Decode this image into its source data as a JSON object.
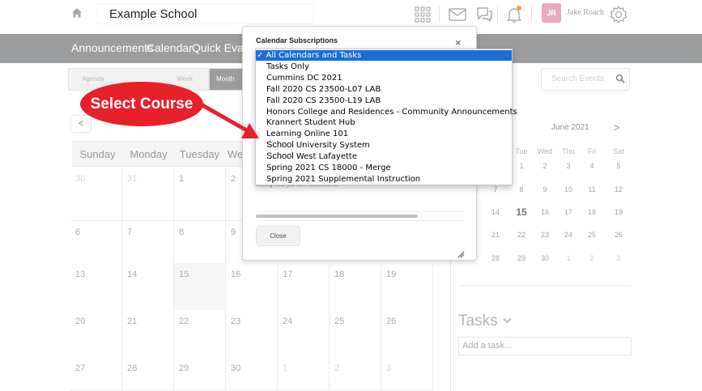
{
  "header": {
    "school_name": "Example School",
    "user_initials": "JR",
    "user_name": "Jake Roach",
    "icons": [
      "home-icon",
      "apps-grid-icon",
      "mail-icon",
      "chat-icon",
      "bell-icon",
      "gear-icon"
    ]
  },
  "navbar": {
    "items": [
      "Announcements",
      "Calendar",
      "Quick Eval"
    ]
  },
  "toolbar": {
    "view_tabs": [
      "Agenda",
      "Week",
      "Month"
    ],
    "search_placeholder": "Search Events"
  },
  "calendar": {
    "prev_label": "<",
    "weekdays": [
      "Sunday",
      "Monday",
      "Tuesday",
      "We"
    ],
    "rows": [
      [
        "30",
        "31",
        "1",
        "2"
      ],
      [
        "6",
        "7",
        "8",
        "9"
      ],
      [
        "13",
        "14",
        "15",
        "16",
        "17",
        "18",
        "19"
      ],
      [
        "20",
        "21",
        "22",
        "23",
        "24",
        "25",
        "26"
      ],
      [
        "27",
        "28",
        "29",
        "30",
        "1",
        "2",
        "3"
      ]
    ]
  },
  "mini_calendar": {
    "title": "June 2021",
    "next_label": ">",
    "weekdays": [
      "Tue",
      "Wed",
      "Thu",
      "Fri",
      "Sat"
    ],
    "rows": [
      [
        "1",
        "2",
        "3",
        "4",
        "5"
      ],
      [
        "7",
        "8",
        "9",
        "10",
        "11",
        "12"
      ],
      [
        "14",
        "15",
        "16",
        "17",
        "18",
        "19"
      ],
      [
        "21",
        "22",
        "23",
        "24",
        "25",
        "26"
      ],
      [
        "28",
        "29",
        "30",
        "1",
        "2",
        "3"
      ]
    ],
    "today": "15"
  },
  "tasks": {
    "title": "Tasks",
    "placeholder": "Add a task..."
  },
  "modal": {
    "title": "Calendar Subscriptions",
    "close_x": "×",
    "partial_text": "existing feeds you have subscribed to.",
    "progress": 0.78,
    "close_button": "Close"
  },
  "dropdown": {
    "selected_index": 0,
    "items": [
      {
        "prefix": "✓ ",
        "text": "All Calendars and Tasks"
      },
      {
        "prefix": "",
        "text": "Tasks Only"
      },
      {
        "prefix": "",
        "text": "Cummins DC 2021"
      },
      {
        "prefix": "",
        "text": "Fall 2020 CS 23500-L07 LAB"
      },
      {
        "prefix": "",
        "text": "Fall 2020 CS 23500-L19 LAB"
      },
      {
        "prefix": "",
        "text": "Honors College and Residences - Community Announcements"
      },
      {
        "prefix": "",
        "text": "Krannert Student Hub"
      },
      {
        "prefix": "",
        "text": "Learning Online 101"
      },
      {
        "prefix": "School",
        "text": " University System"
      },
      {
        "prefix": "School",
        "text": " West Lafayette"
      },
      {
        "prefix": "",
        "text": "Spring 2021 CS 18000 - Merge"
      },
      {
        "prefix": "",
        "text": "Spring 2021 Supplemental Instruction"
      }
    ]
  },
  "annotation": {
    "callout_text": "Select Course",
    "color": "#e8202a"
  }
}
